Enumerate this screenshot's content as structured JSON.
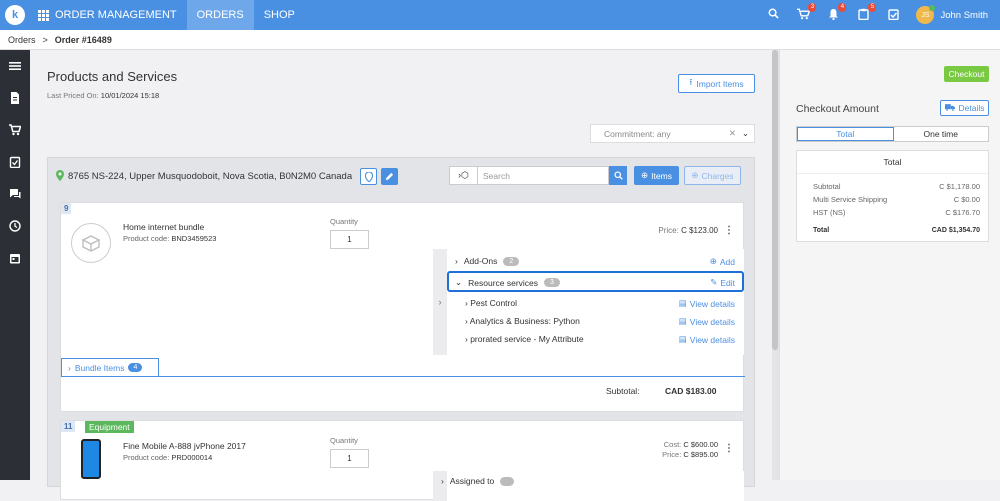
{
  "topbar": {
    "logo_letter": "k",
    "app_name": "ORDER MANAGEMENT",
    "tabs": [
      {
        "label": "ORDERS",
        "active": true
      },
      {
        "label": "SHOP",
        "active": false
      }
    ],
    "cart_badge": "3",
    "bell_badge": "4",
    "tasks_badge": "5",
    "user_initials": "JS",
    "user_name": "John Smith"
  },
  "breadcrumb": {
    "root": "Orders",
    "sep": ">",
    "current": "Order #16489"
  },
  "page": {
    "title": "Products and Services",
    "last_priced_label": "Last Priced On:",
    "last_priced_value": "10/01/2024 15:18",
    "import_label": "Import Items",
    "commitment_value": "Commitment: any"
  },
  "location": {
    "address": "8765 NS-224, Upper Musquodoboit, Nova Scotia, B0N2M0 Canada",
    "search_placeholder": "Search",
    "items_label": "Items",
    "charges_label": "Charges"
  },
  "item1": {
    "number": "9",
    "name": "Home internet bundle",
    "code_label": "Product code:",
    "code": "BND3459523",
    "qty_label": "Quantity",
    "qty": "1",
    "price_label": "Price:",
    "price": "C $123.00",
    "addons_label": "Add-Ons",
    "addons_count": "2",
    "add_label": "Add",
    "resources_label": "Resource services",
    "resources_count": "3",
    "edit_label": "Edit",
    "sub_items": [
      {
        "label": "Pest Control",
        "link": "View details"
      },
      {
        "label": "Analytics & Business: Python",
        "link": "View details"
      },
      {
        "label": "prorated service - My Attribute",
        "link": "View details"
      }
    ],
    "bundle_label": "Bundle Items",
    "bundle_count": "4",
    "subtotal_label": "Subtotal:",
    "subtotal_value": "CAD $183.00"
  },
  "item2": {
    "number": "11",
    "tag": "Equipment",
    "name": "Fine Mobile A-888 jvPhone 2017",
    "code_label": "Product code:",
    "code": "PRD000014",
    "qty_label": "Quantity",
    "qty": "1",
    "cost_label": "Cost:",
    "cost": "C $600.00",
    "price_label": "Price:",
    "price": "C $895.00",
    "assigned_label": "Assigned to"
  },
  "checkout": {
    "button": "Checkout",
    "title": "Checkout Amount",
    "details_label": "Details",
    "toggle": [
      "Total",
      "One time"
    ],
    "box_title": "Total",
    "rows": [
      {
        "label": "Subtotal",
        "value": "C $1,178.00"
      },
      {
        "label": "Multi Service Shipping",
        "value": "C $0.00"
      },
      {
        "label": "HST (NS)",
        "value": "C $176.70"
      }
    ],
    "total_label": "Total",
    "total_value": "CAD $1,354.70"
  }
}
